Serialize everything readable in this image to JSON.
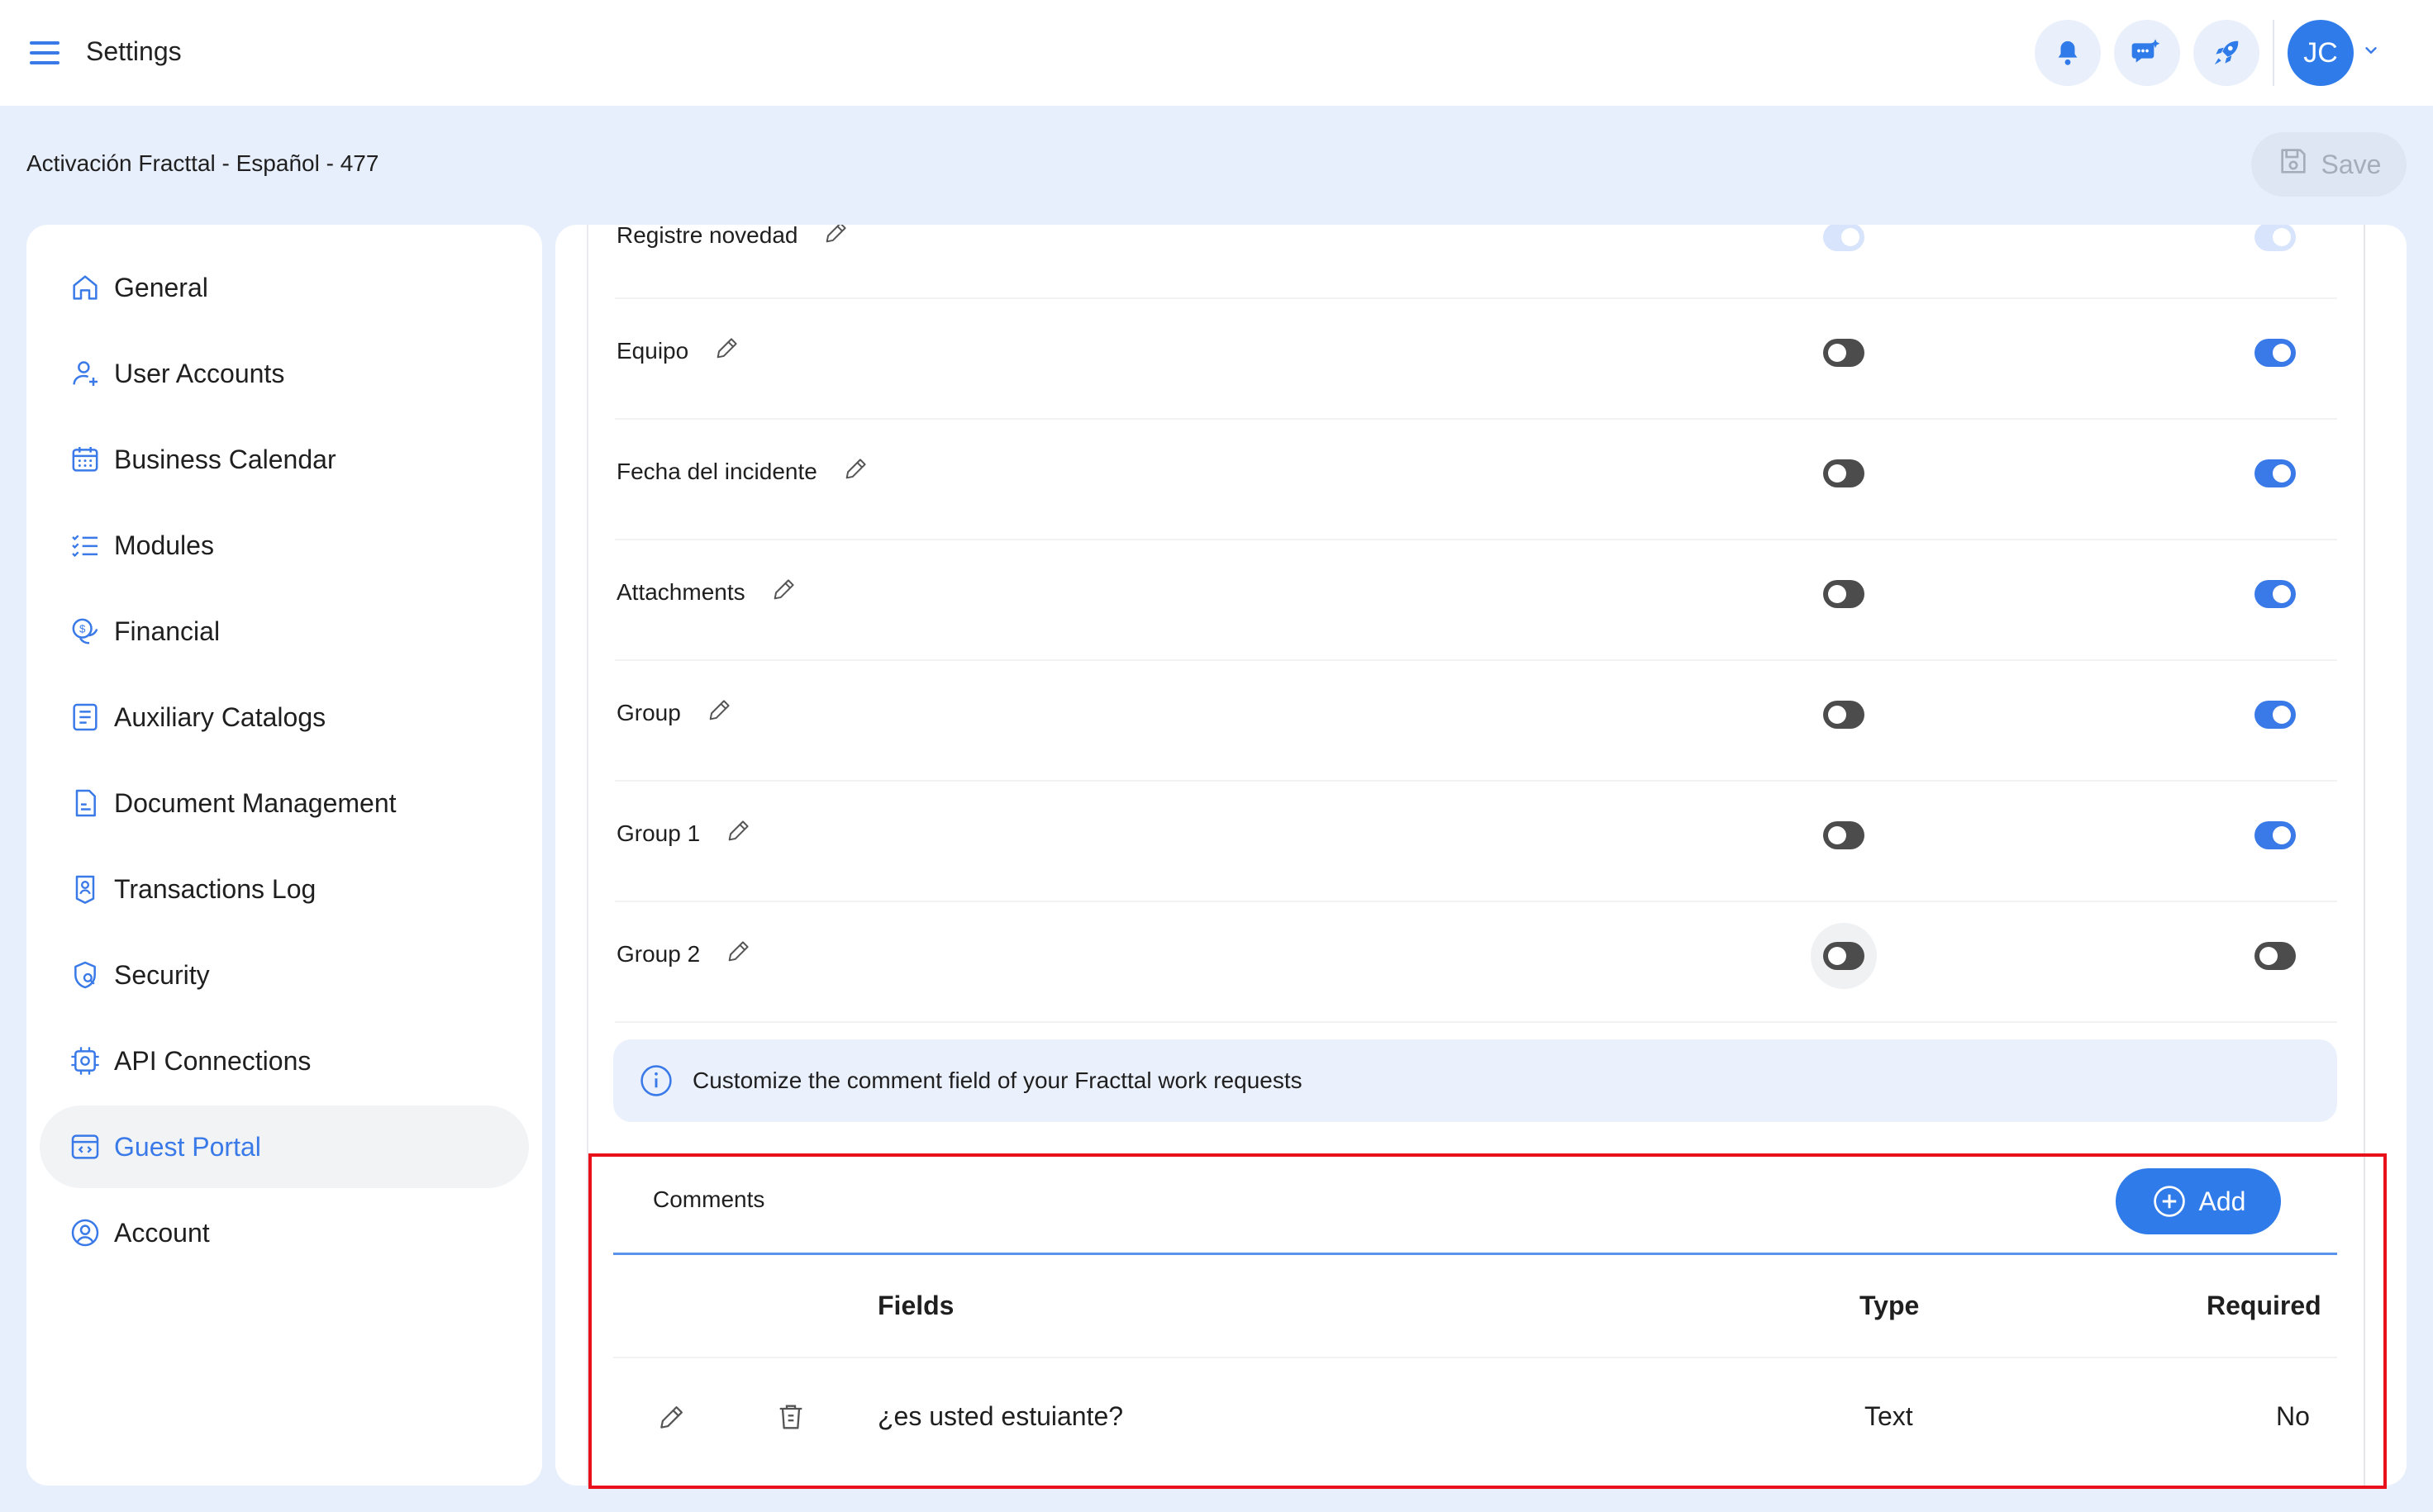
{
  "header": {
    "title": "Settings",
    "menu_icon": "menu-icon",
    "actions": [
      {
        "name": "notifications-bell",
        "icon": "bell-icon"
      },
      {
        "name": "chat-support",
        "icon": "chat-sparkle-icon"
      },
      {
        "name": "launch-rocket",
        "icon": "rocket-icon"
      }
    ],
    "user_initials": "JC"
  },
  "subheader": {
    "breadcrumb": "Activación Fracttal - Español - 477",
    "save_label": "Save"
  },
  "sidebar": {
    "items": [
      {
        "label": "General",
        "icon": "home-icon",
        "active": false
      },
      {
        "label": "User Accounts",
        "icon": "user-add-icon",
        "active": false
      },
      {
        "label": "Business Calendar",
        "icon": "calendar-icon",
        "active": false
      },
      {
        "label": "Modules",
        "icon": "checklist-icon",
        "active": false
      },
      {
        "label": "Financial",
        "icon": "coins-icon",
        "active": false
      },
      {
        "label": "Auxiliary Catalogs",
        "icon": "catalog-icon",
        "active": false
      },
      {
        "label": "Document Management",
        "icon": "document-icon",
        "active": false
      },
      {
        "label": "Transactions Log",
        "icon": "log-icon",
        "active": false
      },
      {
        "label": "Security",
        "icon": "shield-icon",
        "active": false
      },
      {
        "label": "API Connections",
        "icon": "api-gear-icon",
        "active": false
      },
      {
        "label": "Guest Portal",
        "icon": "portal-icon",
        "active": true
      },
      {
        "label": "Account",
        "icon": "account-icon",
        "active": false
      }
    ]
  },
  "fields": [
    {
      "label": "Registre novedad",
      "toggle_a": "on",
      "toggle_b": "on"
    },
    {
      "label": "Equipo",
      "toggle_a": "off",
      "toggle_b": "on"
    },
    {
      "label": "Fecha del incidente",
      "toggle_a": "off",
      "toggle_b": "on"
    },
    {
      "label": "Attachments",
      "toggle_a": "off",
      "toggle_b": "on"
    },
    {
      "label": "Group",
      "toggle_a": "off",
      "toggle_b": "on"
    },
    {
      "label": "Group 1",
      "toggle_a": "off",
      "toggle_b": "on"
    },
    {
      "label": "Group 2",
      "toggle_a": "off",
      "toggle_b": "off"
    }
  ],
  "info_banner": {
    "text": "Customize the comment field of your Fracttal work requests",
    "icon": "info-icon"
  },
  "comments": {
    "title": "Comments",
    "add_label": "Add",
    "columns": {
      "fields": "Fields",
      "type": "Type",
      "required": "Required"
    },
    "rows": [
      {
        "field": "¿es usted estuiante?",
        "type": "Text",
        "required": "No"
      }
    ]
  },
  "colors": {
    "accent": "#2f7bea",
    "page_bg": "#e8effc",
    "highlight": "#e8101a"
  }
}
